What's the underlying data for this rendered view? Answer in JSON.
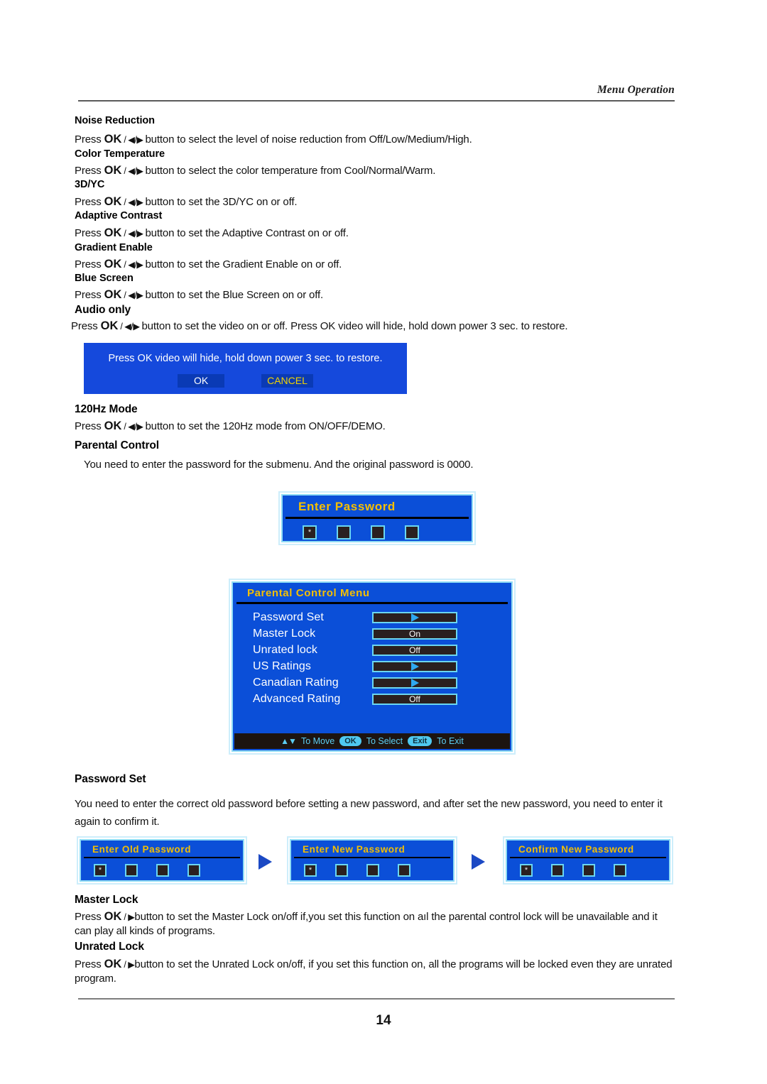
{
  "header": {
    "title": "Menu Operation"
  },
  "page": {
    "number": "14"
  },
  "sections": [
    {
      "heading": "Noise Reduction",
      "body_pre": "Press ",
      "body_key": "OK",
      "body_arrows": " / ◀/▶ ",
      "body_post": "button to select the level of noise reduction from Off/Low/Medium/High."
    },
    {
      "heading": "Color Temperature",
      "body_pre": "Press ",
      "body_key": "OK",
      "body_arrows": " / ◀/▶ ",
      "body_post": "button to select the color temperature from Cool/Normal/Warm."
    },
    {
      "heading": "3D/YC",
      "body_pre": "Press ",
      "body_key": "OK",
      "body_arrows": " / ◀/▶ ",
      "body_post": "button to set the 3D/YC on or off."
    },
    {
      "heading": "Adaptive Contrast",
      "body_pre": "Press ",
      "body_key": "OK",
      "body_arrows": " / ◀/▶ ",
      "body_post": "button to set the Adaptive Contrast on or off."
    },
    {
      "heading": "Gradient Enable",
      "body_pre": "Press ",
      "body_key": "OK",
      "body_arrows": " / ◀/▶ ",
      "body_post": "button to set the Gradient Enable on or off."
    },
    {
      "heading": "Blue Screen",
      "body_pre": "Press ",
      "body_key": "OK",
      "body_arrows": " / ◀/▶ ",
      "body_post": "button to set the Blue Screen on or off."
    },
    {
      "heading": "Audio only",
      "body_pre": "Press ",
      "body_key": "OK",
      "body_arrows": " / ◀/▶ ",
      "body_post": "button to set the video on or off. Press OK video will hide, hold down power 3 sec. to restore."
    },
    {
      "heading": "120Hz Mode",
      "body_pre": "Press ",
      "body_key": "OK",
      "body_arrows": " / ◀/▶ ",
      "body_post": "button to set the 120Hz mode from ON/OFF/DEMO."
    },
    {
      "heading": "Parental Control",
      "body_pre": "",
      "body_key": "",
      "body_arrows": "",
      "body_post": "You need to enter the password for the submenu. And the original password is 0000."
    },
    {
      "heading": "Password Set",
      "body_pre": "",
      "body_key": "",
      "body_arrows": "",
      "body_post": "You need to enter the correct old password before setting a new password, and after set the new password, you need to enter it again to confirm it."
    },
    {
      "heading": "Master Lock",
      "body_pre": "Press ",
      "body_key": "OK",
      "body_arrows": " / ▶",
      "body_post": "button to set the Master Lock on/off  if,you set this function on  aıl the parental control lock will be unavailable and it can play all kinds of programs."
    },
    {
      "heading": "Unrated Lock",
      "body_pre": "Press ",
      "body_key": "OK",
      "body_arrows": " / ▶",
      "body_post": "button to set the Unrated Lock on/off, if you set this function on, all the programs will be locked even they are unrated program."
    }
  ],
  "audio_dialog": {
    "message": "Press OK video will hide, hold down power 3 sec. to restore.",
    "ok_label": "OK",
    "cancel_label": "CANCEL",
    "bg_color": "#1549dc",
    "button_bg": "#0a3ab5",
    "ok_text_color": "#ffffff",
    "cancel_text_color": "#f2d400"
  },
  "enter_password_osd": {
    "title": "Enter Password",
    "cells": [
      "*",
      "",
      "",
      ""
    ]
  },
  "parental_menu": {
    "title": "Parental Control Menu",
    "rows": [
      {
        "label": "Password Set",
        "value": "",
        "type": "arrow"
      },
      {
        "label": "Master Lock",
        "value": "On",
        "type": "text"
      },
      {
        "label": "Unrated lock",
        "value": "Off",
        "type": "text"
      },
      {
        "label": "US Ratings",
        "value": "",
        "type": "arrow"
      },
      {
        "label": "Canadian Rating",
        "value": "",
        "type": "arrow"
      },
      {
        "label": "Advanced Rating",
        "value": "Off",
        "type": "text"
      }
    ],
    "footer": {
      "move_label": "To Move",
      "ok_badge": "OK",
      "select_label": "To Select",
      "exit_badge": "Exit",
      "exit_label": "To Exit"
    },
    "colors": {
      "background": "#0b4fd8",
      "border": "#8fdcf5",
      "title": "#f5bf00",
      "value_box": "#2a2020",
      "value_border": "#6bd6f0",
      "footer_bg": "#1c1410",
      "footer_text": "#5bcdf2",
      "badge_bg": "#4fc9f0"
    }
  },
  "password_flow": {
    "boxes": [
      {
        "title": "Enter Old Password",
        "cells": [
          "*",
          "",
          "",
          ""
        ]
      },
      {
        "title": "Enter New Password",
        "cells": [
          "*",
          "",
          "",
          ""
        ]
      },
      {
        "title": "Confirm New Password",
        "cells": [
          "*",
          "",
          "",
          ""
        ]
      }
    ],
    "arrow_color": "#1b49c4"
  }
}
